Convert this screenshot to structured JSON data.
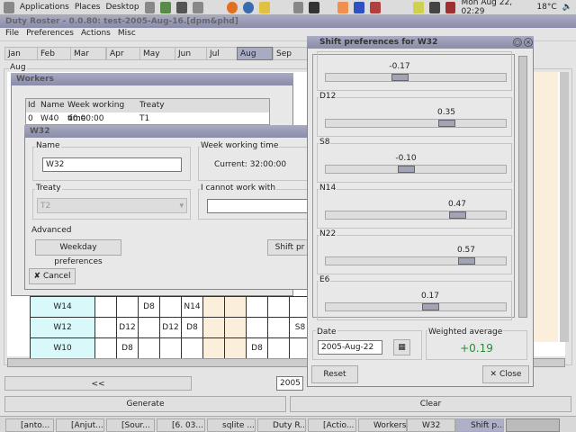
{
  "top_panel": {
    "menus": [
      "Applications",
      "Places",
      "Desktop"
    ],
    "clock": "Mon Aug 22, 02:29",
    "weather": "18°C"
  },
  "main_window": {
    "title": "Duty Roster - 0.0.80: test-2005-Aug-16.[dpm&phd]",
    "menu": [
      "File",
      "Preferences",
      "Actions",
      "Misc"
    ],
    "months": [
      "Jan",
      "Feb",
      "Mar",
      "Apr",
      "May",
      "Jun",
      "Jul",
      "Aug",
      "Sep"
    ],
    "selected_month": "Aug",
    "group_label": "Aug",
    "rows": [
      {
        "name": "W14",
        "cells": [
          "",
          "",
          "D8",
          "",
          "N14",
          "",
          "",
          "",
          "",
          ""
        ]
      },
      {
        "name": "W12",
        "cells": [
          "",
          "D12",
          "",
          "D12",
          "D8",
          "",
          "",
          "",
          "",
          "S8"
        ]
      },
      {
        "name": "W10",
        "cells": [
          "",
          "D8",
          "",
          "",
          "",
          "",
          "",
          "D8",
          "",
          ""
        ]
      }
    ],
    "prev_label": "<<",
    "year": "2005",
    "generate_label": "Generate",
    "clear_label": "Clear"
  },
  "workers_window": {
    "title": "Workers",
    "columns": [
      "Id",
      "Name",
      "Week working time",
      "Treaty"
    ],
    "rows": [
      {
        "id": "0",
        "name": "W40",
        "time": "40:00:00",
        "treaty": "T1"
      }
    ]
  },
  "worker_dialog": {
    "title": "W32",
    "name_label": "Name",
    "name_value": "W32",
    "wwt_label": "Week working time",
    "wwt_value": "Current: 32:00:00",
    "treaty_label": "Treaty",
    "treaty_value": "T2",
    "cannot_label": "I cannot work with",
    "advanced_label": "Advanced",
    "weekday_btn": "Weekday preferences",
    "shift_btn": "Shift pr",
    "cancel_label": "Cancel"
  },
  "shift_prefs": {
    "title": "Shift preferences for W32",
    "range": [
      -1,
      1
    ],
    "sliders": [
      {
        "label": "",
        "value": -0.17,
        "text": "-0.17"
      },
      {
        "label": "D12",
        "value": 0.35,
        "text": "0.35"
      },
      {
        "label": "S8",
        "value": -0.1,
        "text": "-0.10"
      },
      {
        "label": "N14",
        "value": 0.47,
        "text": "0.47"
      },
      {
        "label": "N22",
        "value": 0.57,
        "text": "0.57"
      },
      {
        "label": "E6",
        "value": 0.17,
        "text": "0.17"
      }
    ],
    "date_label": "Date",
    "date_value": "2005-Aug-22",
    "avg_label": "Weighted average",
    "avg_value": "+0.19",
    "avg_color": "#2a8a3a",
    "reset_label": "Reset",
    "close_label": "Close"
  },
  "taskbar": [
    "[anto...",
    "[Anjut...",
    "[Sour...",
    "[6. 03...",
    "sqlite ...",
    "Duty R...",
    "[Actio...",
    "Workers",
    "W32",
    "Shift p..."
  ],
  "taskbar_active": "Shift p..."
}
